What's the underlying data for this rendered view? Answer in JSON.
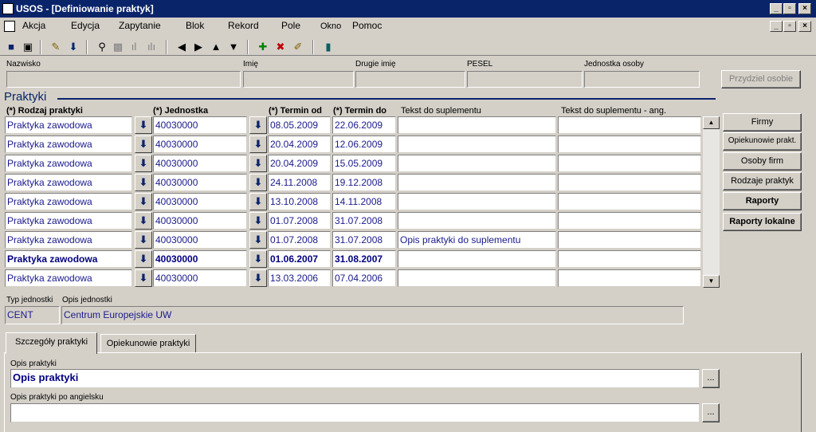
{
  "window": {
    "title": "USOS - [Definiowanie praktyk]"
  },
  "menu": {
    "items": [
      "Akcja",
      "Edycja",
      "Zapytanie",
      "Blok",
      "Rekord",
      "Pole",
      "Okno",
      "Pomoc"
    ]
  },
  "person": {
    "labels": {
      "nazwisko": "Nazwisko",
      "imie": "Imię",
      "drugie_imie": "Drugie imię",
      "pesel": "PESEL",
      "jednostka": "Jednostka osoby"
    },
    "values": {
      "nazwisko": "",
      "imie": "",
      "drugie_imie": "",
      "pesel": "",
      "jednostka": ""
    },
    "assign_button": "Przydziel osobie"
  },
  "section": {
    "title": "Praktyki"
  },
  "grid": {
    "columns": {
      "rodzaj": "(*) Rodzaj praktyki",
      "jednostka": "(*) Jednostka",
      "termin_od": "(*) Termin od",
      "termin_do": "(*) Termin do",
      "tekst": "Tekst do suplementu",
      "tekst_ang": "Tekst do suplementu - ang."
    },
    "rows": [
      {
        "rodzaj": "Praktyka zawodowa",
        "jednostka": "40030000",
        "od": "08.05.2009",
        "do": "22.06.2009",
        "tekst": "",
        "tekst_ang": ""
      },
      {
        "rodzaj": "Praktyka zawodowa",
        "jednostka": "40030000",
        "od": "20.04.2009",
        "do": "12.06.2009",
        "tekst": "",
        "tekst_ang": ""
      },
      {
        "rodzaj": "Praktyka zawodowa",
        "jednostka": "40030000",
        "od": "20.04.2009",
        "do": "15.05.2009",
        "tekst": "",
        "tekst_ang": ""
      },
      {
        "rodzaj": "Praktyka zawodowa",
        "jednostka": "40030000",
        "od": "24.11.2008",
        "do": "19.12.2008",
        "tekst": "",
        "tekst_ang": ""
      },
      {
        "rodzaj": "Praktyka zawodowa",
        "jednostka": "40030000",
        "od": "13.10.2008",
        "do": "14.11.2008",
        "tekst": "",
        "tekst_ang": ""
      },
      {
        "rodzaj": "Praktyka zawodowa",
        "jednostka": "40030000",
        "od": "01.07.2008",
        "do": "31.07.2008",
        "tekst": "",
        "tekst_ang": ""
      },
      {
        "rodzaj": "Praktyka zawodowa",
        "jednostka": "40030000",
        "od": "01.07.2008",
        "do": "31.07.2008",
        "tekst": "Opis praktyki do suplementu",
        "tekst_ang": ""
      },
      {
        "rodzaj": "Praktyka zawodowa",
        "jednostka": "40030000",
        "od": "01.06.2007",
        "do": "31.08.2007",
        "tekst": "",
        "tekst_ang": "",
        "current": true
      },
      {
        "rodzaj": "Praktyka zawodowa",
        "jednostka": "40030000",
        "od": "13.03.2006",
        "do": "07.04.2006",
        "tekst": "",
        "tekst_ang": ""
      }
    ]
  },
  "side_buttons": {
    "firmy": "Firmy",
    "opiekunowie": "Opiekunowie prakt.",
    "osoby_firm": "Osoby firm",
    "rodzaje": "Rodzaje praktyk",
    "raporty": "Raporty",
    "raporty_lokalne": "Raporty lokalne"
  },
  "unit": {
    "typ_label": "Typ jednostki",
    "typ_value": "CENT",
    "opis_label": "Opis jednostki",
    "opis_value": "Centrum Europejskie UW"
  },
  "tabs": {
    "details": "Szczegóły praktyki",
    "guardians": "Opiekunowie praktyki"
  },
  "details": {
    "opis_label": "Opis praktyki",
    "opis_value": "Opis praktyki",
    "opis_en_label": "Opis praktyki po angielsku",
    "opis_en_value": "",
    "ellipsis": "..."
  },
  "colors": {
    "title_bar": "#0a246a",
    "text_blue": "#1a1a8c",
    "window_bg": "#d4d0c8"
  }
}
